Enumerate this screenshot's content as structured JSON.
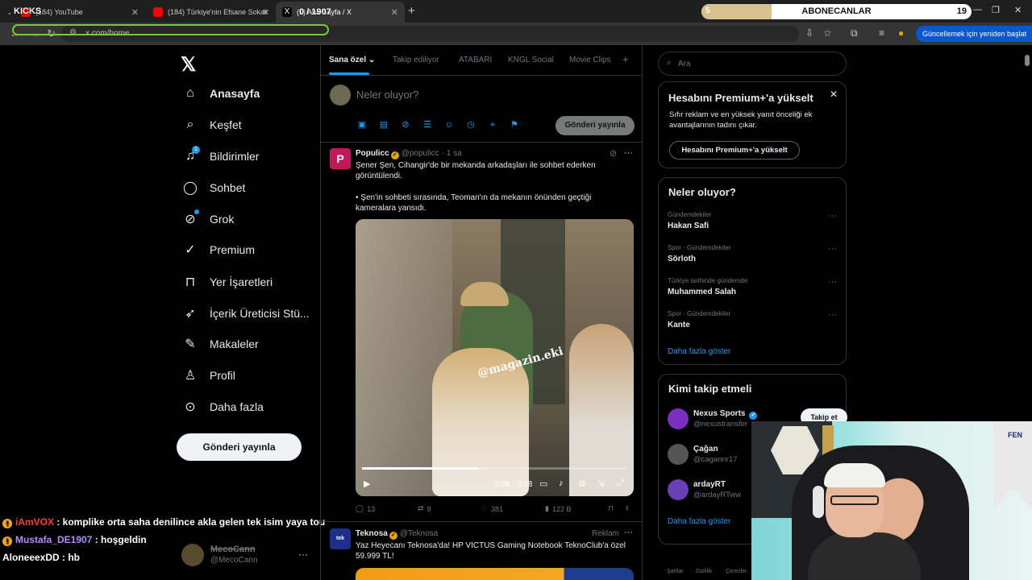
{
  "browser": {
    "tabs": [
      {
        "label": "(184) YouTube",
        "icon": "youtube-icon"
      },
      {
        "label": "(184) Türkiye'nin Efsane Sokak",
        "icon": "youtube-icon"
      },
      {
        "label": "(1) Ana Sayfa / X",
        "icon": "x-icon"
      }
    ],
    "url": "x.com/home",
    "update_button": "Güncellemek için yeniden başlat"
  },
  "stream_overlay": {
    "kicks_label": "KICKS",
    "counter": "0 / 1907",
    "sub_goal": {
      "label": "ABONECANLAR",
      "current": "5",
      "target": "19",
      "progress": 0.26
    }
  },
  "nav": {
    "items": [
      {
        "label": "Anasayfa",
        "icon": "home-icon",
        "bold": true
      },
      {
        "label": "Keşfet",
        "icon": "search-icon"
      },
      {
        "label": "Bildirimler",
        "icon": "bell-icon",
        "badge": "1"
      },
      {
        "label": "Sohbet",
        "icon": "chat-icon"
      },
      {
        "label": "Grok",
        "icon": "grok-icon"
      },
      {
        "label": "Premium",
        "icon": "premium-icon"
      },
      {
        "label": "Yer İşaretleri",
        "icon": "bookmark-icon"
      },
      {
        "label": "İçerik Üreticisi Stü...",
        "icon": "rocket-icon"
      },
      {
        "label": "Makaleler",
        "icon": "article-icon"
      },
      {
        "label": "Profil",
        "icon": "profile-icon"
      },
      {
        "label": "Daha fazla",
        "icon": "more-icon"
      }
    ],
    "post_button": "Gönderi yayınla",
    "account": {
      "name": "MecoCann",
      "handle": "@MecoCann"
    }
  },
  "chat": [
    {
      "user": "iAmVOX",
      "color": "#ff3b3b",
      "message": " : komplike orta saha denilince akla gelen tek isim yaya tou"
    },
    {
      "user": "Mustafa_DE1907",
      "color": "#b48bff",
      "message": " : hoşgeldin"
    },
    {
      "user": "AloneeexDD",
      "color": "#ffffff",
      "message": " : hb"
    }
  ],
  "feed": {
    "tabs": [
      "Sana özel",
      "Takip ediliyor",
      "ATABARI",
      "KNGL Social",
      "Movie Clips"
    ],
    "compose": {
      "placeholder": "Neler oluyor?",
      "button": "Gönderi yayınla"
    },
    "posts": [
      {
        "name": "Populicc",
        "handle": "@populicc",
        "time": "1 sa",
        "avatar_letter": "P",
        "avatar_color": "#c2185b",
        "text1": "Şener Şen, Cihangir'de bir mekanda arkadaşları ile sohbet ederken görüntülendi.",
        "text2": "• Şen'in sohbeti sırasında, Teoman'ın da mekanın önünden geçtiği kameralara yansıdı.",
        "video": {
          "watermark": "@magazin.eki",
          "time": "0:08 / 0:18",
          "progress": 0.44
        },
        "stats": {
          "replies": "13",
          "reposts": "9",
          "likes": "381",
          "views": "122 B"
        }
      },
      {
        "name": "Teknosa",
        "handle": "@Teknosa",
        "ad_label": "Reklam",
        "avatar_color": "#1a2e8a",
        "text1": "Yaz Heyecanı Teknosa'da! HP VICTUS Gaming Notebook TeknoClub'a özel 59.999 TL!"
      }
    ]
  },
  "sidebar": {
    "search_placeholder": "Ara",
    "premium": {
      "title": "Hesabını Premium+'a yükselt",
      "text": "Sıfır reklam ve en yüksek yanıt önceliği ek avantajlarının tadını çıkar.",
      "button": "Hesabını Premium+'a yükselt"
    },
    "trends": {
      "title": "Neler oluyor?",
      "items": [
        {
          "category": "Gündemdekiler",
          "name": "Hakan Safi"
        },
        {
          "category": "Spor · Gündemdekiler",
          "name": "Sörloth"
        },
        {
          "category": "Türkiye tarihinde gündemde",
          "name": "Muhammed Salah"
        },
        {
          "category": "Spor · Gündemdekiler",
          "name": "Kante"
        }
      ],
      "show_more": "Daha fazla göster"
    },
    "who_to_follow": {
      "title": "Kimi takip etmeli",
      "items": [
        {
          "name": "Nexus Sports",
          "handle": "@nexustransfer",
          "color": "#7b2fbe"
        },
        {
          "name": "Çağan",
          "handle": "@cagannr17",
          "color": "#555555"
        },
        {
          "name": "ardayRT",
          "handle": "@ardayRTww",
          "color": "#6a3fb5"
        }
      ],
      "follow_button": "Takip et",
      "show_more": "Daha fazla göster"
    },
    "footer": [
      "Şartlar",
      "Gizlilik",
      "Çerezler"
    ]
  },
  "webcam": {
    "flag_text": "FEN"
  }
}
